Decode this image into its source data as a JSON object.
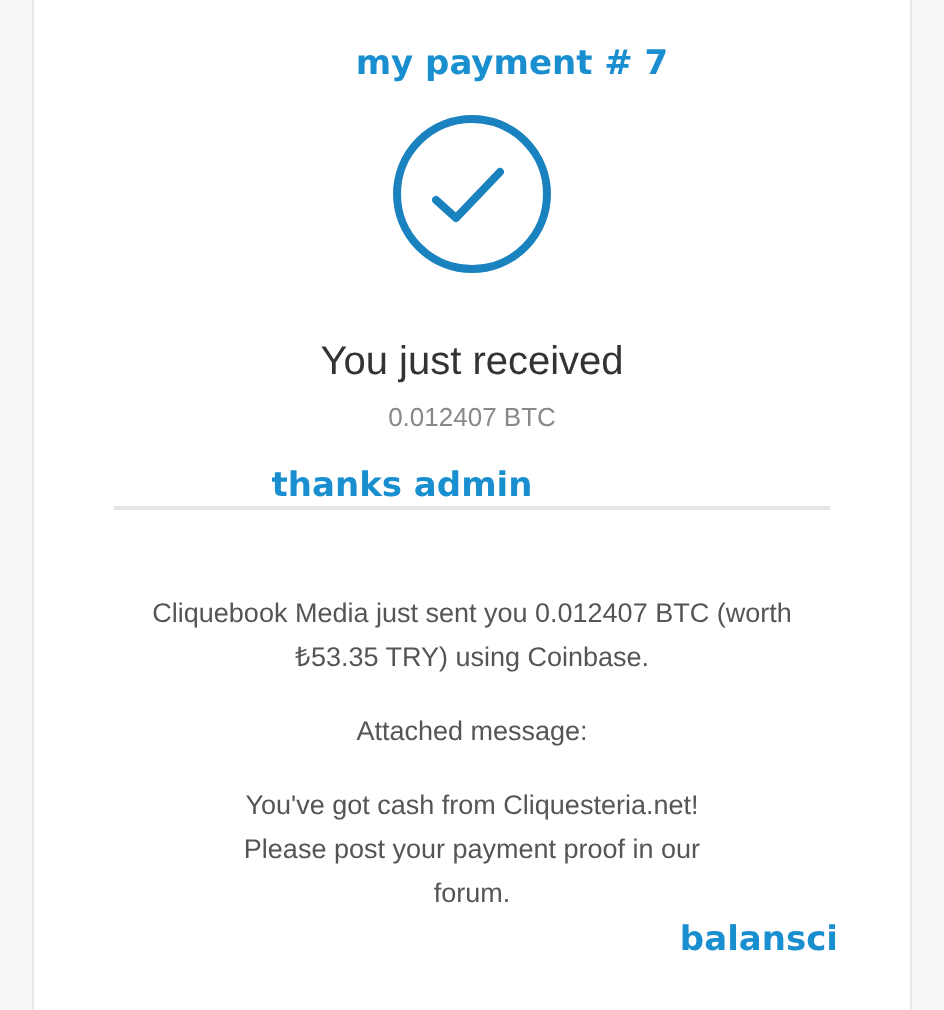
{
  "annotations": {
    "title": "my payment # 7",
    "thanks": "thanks admin",
    "signature": "balansci"
  },
  "receipt": {
    "heading": "You just received",
    "amount": "0.012407 BTC",
    "details": "Cliquebook Media just sent you 0.012407 BTC (worth ₺53.35 TRY) using Coinbase.",
    "message_label": "Attached message:",
    "message": "You've got cash from Cliquesteria.net! Please post your payment proof in our forum."
  }
}
